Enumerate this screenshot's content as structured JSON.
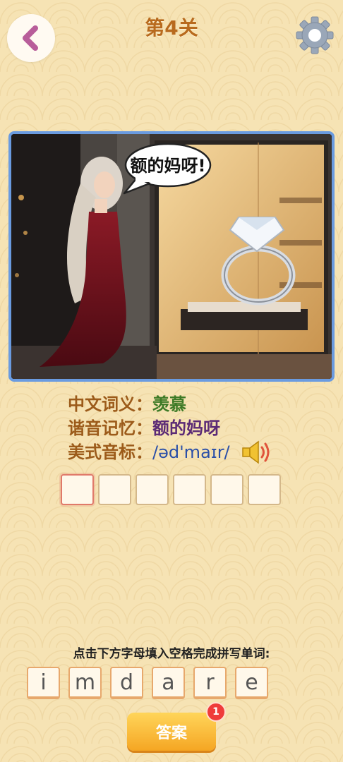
{
  "header": {
    "title": "第4关",
    "back_icon": "back-chevron-icon",
    "settings_icon": "gear-icon"
  },
  "scene": {
    "speech_bubble": "额的妈呀!"
  },
  "info": {
    "meaning_label": "中文词义：",
    "meaning_value": "羡慕",
    "memory_label": "谐音记忆：",
    "memory_value": "额的妈呀",
    "phonetic_label": "美式音标：",
    "phonetic_value": "/əd'maɪr/",
    "speaker_icon": "speaker-icon"
  },
  "answer_slots": [
    "",
    "",
    "",
    "",
    "",
    ""
  ],
  "instruction": "点击下方字母填入空格完成拼写单词:",
  "letters": [
    "i",
    "m",
    "d",
    "a",
    "r",
    "e"
  ],
  "answer_button": {
    "label": "答案",
    "badge": "1"
  },
  "colors": {
    "background": "#f6e3b4",
    "title": "#b86a1d",
    "accent_button": "#f5a623",
    "badge": "#ef3b3b"
  }
}
